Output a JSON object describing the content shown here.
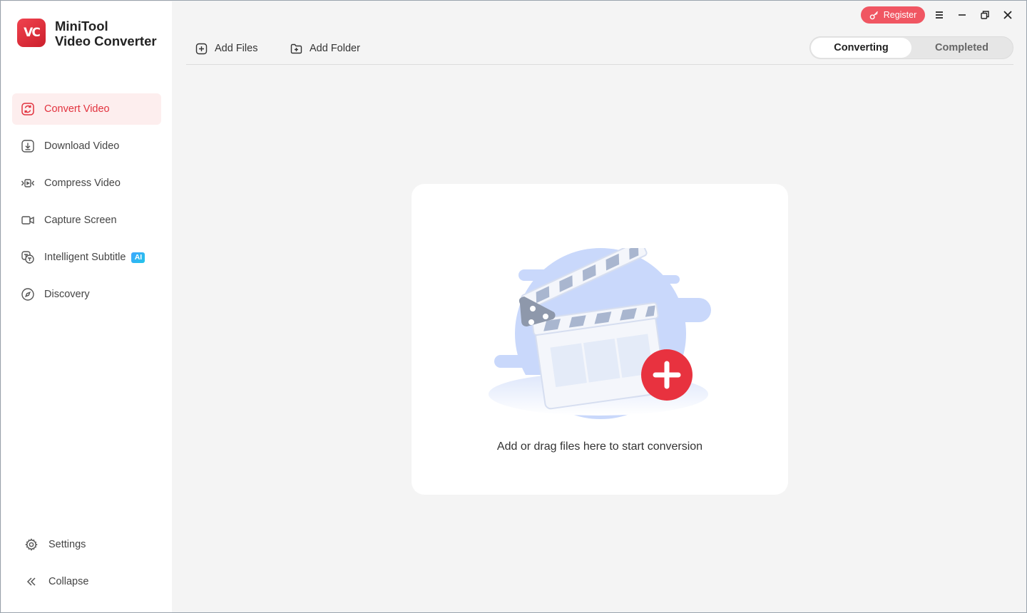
{
  "app": {
    "name_line1": "MiniTool",
    "name_line2": "Video Converter",
    "logo_text": "VC"
  },
  "titlebar": {
    "register_label": "Register"
  },
  "sidebar": {
    "items": [
      {
        "label": "Convert Video",
        "icon": "convert-icon",
        "active": true
      },
      {
        "label": "Download Video",
        "icon": "download-icon",
        "active": false
      },
      {
        "label": "Compress Video",
        "icon": "compress-icon",
        "active": false
      },
      {
        "label": "Capture Screen",
        "icon": "camera-icon",
        "active": false
      },
      {
        "label": "Intelligent Subtitle",
        "icon": "subtitle-icon",
        "active": false,
        "badge": "AI"
      },
      {
        "label": "Discovery",
        "icon": "compass-icon",
        "active": false
      }
    ],
    "bottom": [
      {
        "label": "Settings",
        "icon": "gear-icon"
      },
      {
        "label": "Collapse",
        "icon": "double-chevron-left-icon"
      }
    ]
  },
  "toolbar": {
    "add_files": "Add Files",
    "add_folder": "Add Folder"
  },
  "tabs": {
    "converting": "Converting",
    "completed": "Completed",
    "selected": "Converting"
  },
  "dropzone": {
    "message": "Add or drag files here to start conversion"
  },
  "colors": {
    "accent": "#e2323e",
    "accent_bg": "#fdeeee",
    "register_bg": "#f05662",
    "illustration_blue": "#c9d8fb"
  }
}
